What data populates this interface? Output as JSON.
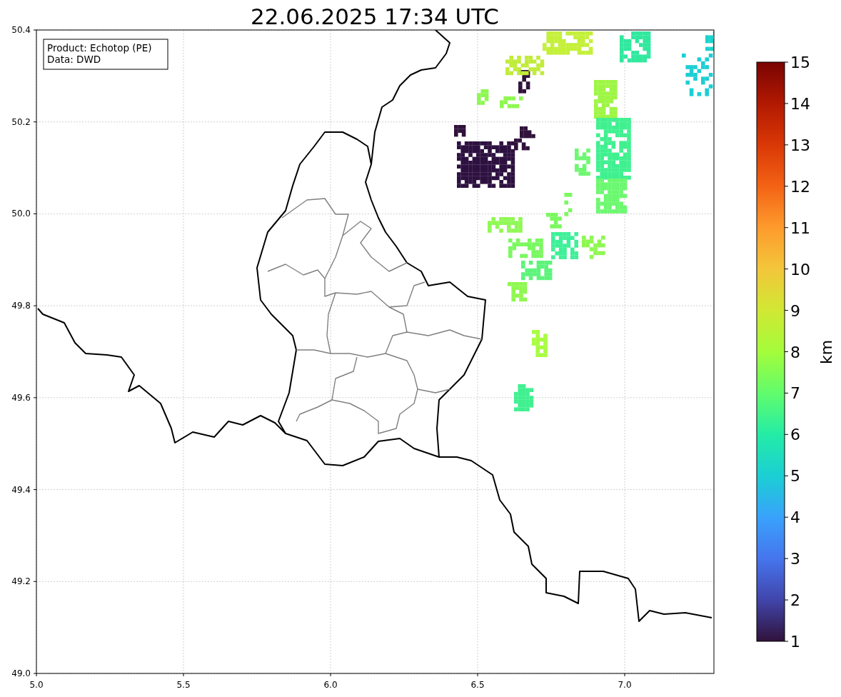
{
  "title": "22.06.2025 17:34 UTC",
  "legend": [
    "Product: Echotop (PE)",
    "Data: DWD"
  ],
  "map": {
    "x_ticks": [
      "5.0",
      "5.5",
      "6.0",
      "6.5",
      "7.0"
    ],
    "y_ticks": [
      "50.4",
      "50.2",
      "50.0",
      "49.8",
      "49.6",
      "49.4",
      "49.2",
      "49.0"
    ]
  },
  "colorbar": {
    "label": "km",
    "ticks": [
      "15",
      "14",
      "13",
      "12",
      "11",
      "10",
      "9",
      "8",
      "7",
      "6",
      "5",
      "4",
      "3",
      "2",
      "1"
    ]
  }
}
